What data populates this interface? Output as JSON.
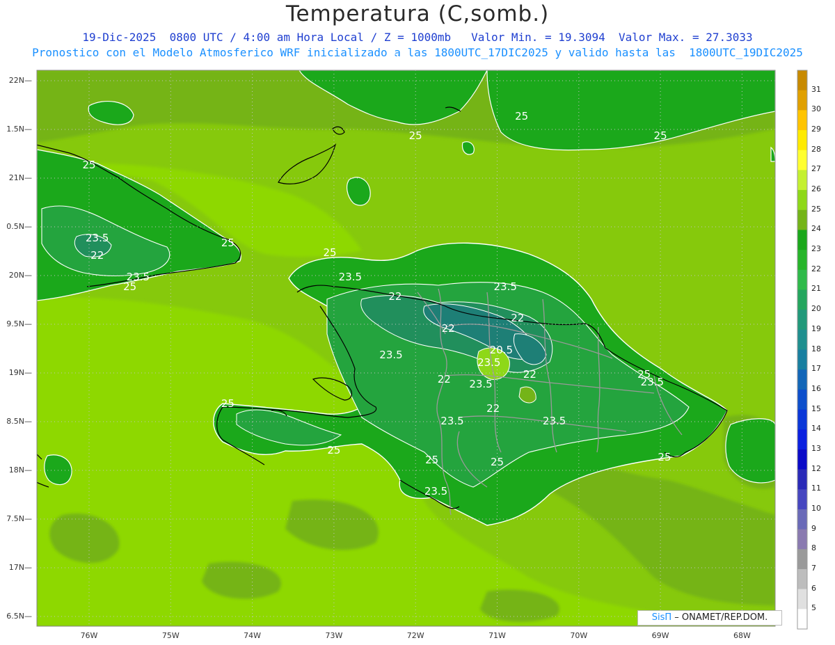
{
  "title": "Temperatura (C,somb.)",
  "subtitle_line1": "19-Dic-2025  0800 UTC / 4:00 am Hora Local / Z = 1000mb   Valor Min. = 19.3094  Valor Max. = 27.3033",
  "subtitle_line2": "Pronostico con el Modelo Atmosferico WRF inicializado a las 1800UTC_17DIC2025 y valido hasta las  1800UTC_19DIC2025",
  "credit": {
    "brand": "SisΠ",
    "text": " – ONAMET/REP.DOM."
  },
  "lat_labels": [
    "22N",
    "1.5N",
    "21N",
    "0.5N",
    "20N",
    "9.5N",
    "19N",
    "8.5N",
    "18N",
    "7.5N",
    "17N",
    "6.5N"
  ],
  "lon_labels": [
    "76W",
    "75W",
    "74W",
    "73W",
    "72W",
    "71W",
    "70W",
    "69W",
    "68W"
  ],
  "colorbar": {
    "levels": [
      "31",
      "30",
      "29",
      "28",
      "27",
      "26",
      "25",
      "24",
      "23",
      "22",
      "21",
      "20",
      "19",
      "18",
      "17",
      "16",
      "15",
      "14",
      "13",
      "12",
      "11",
      "10",
      "9",
      "8",
      "7",
      "6",
      "5"
    ],
    "colors": [
      "#c88a00",
      "#e0a000",
      "#ffc400",
      "#ffea00",
      "#ffff30",
      "#c4f030",
      "#8ed818",
      "#74b418",
      "#1ba81b",
      "#27b52a",
      "#2fba4a",
      "#24a65e",
      "#21997a",
      "#1f8f8f",
      "#187fa0",
      "#1266b8",
      "#0d4fcc",
      "#0a37d8",
      "#0a20e0",
      "#0a0ac8",
      "#2a2ab8",
      "#4646c0",
      "#6a6ab8",
      "#8a7ab0",
      "#9a9a9a",
      "#bdbdbd",
      "#e0e0e0",
      "#ffffff"
    ]
  },
  "map": {
    "colors": {
      "sea_bright": "#8ed800",
      "sea_mid": "#86c90c",
      "sea_deep": "#74b418",
      "land_warm": "#1ba81b",
      "land_mid": "#24a43e",
      "land_cool": "#218f5c",
      "land_cold": "#1e7f76",
      "coast": "#000000",
      "border": "#9a9a9a",
      "contour": "#ffffff"
    },
    "contour_labels": [
      {
        "text": "25",
        "lon": -72.2,
        "lat": 22.2
      },
      {
        "text": "25",
        "lon": -70.7,
        "lat": 21.6
      },
      {
        "text": "25",
        "lon": -72.0,
        "lat": 21.4
      },
      {
        "text": "25",
        "lon": -69.0,
        "lat": 21.4
      },
      {
        "text": "25",
        "lon": -76.0,
        "lat": 21.1
      },
      {
        "text": "25",
        "lon": -74.3,
        "lat": 20.3
      },
      {
        "text": "25",
        "lon": -75.5,
        "lat": 19.85
      },
      {
        "text": "25",
        "lon": -73.05,
        "lat": 20.2
      },
      {
        "text": "25",
        "lon": -74.3,
        "lat": 18.65
      },
      {
        "text": "25",
        "lon": -73.0,
        "lat": 18.17
      },
      {
        "text": "25",
        "lon": -71.8,
        "lat": 18.07
      },
      {
        "text": "25",
        "lon": -71.0,
        "lat": 18.05
      },
      {
        "text": "25",
        "lon": -69.2,
        "lat": 18.95
      },
      {
        "text": "25",
        "lon": -68.95,
        "lat": 18.1
      },
      {
        "text": "23.5",
        "lon": -75.9,
        "lat": 20.35
      },
      {
        "text": "22",
        "lon": -75.9,
        "lat": 20.17
      },
      {
        "text": "23.5",
        "lon": -75.4,
        "lat": 19.95
      },
      {
        "text": "23.5",
        "lon": -72.8,
        "lat": 19.95
      },
      {
        "text": "22",
        "lon": -72.25,
        "lat": 19.75
      },
      {
        "text": "23.5",
        "lon": -70.9,
        "lat": 19.85
      },
      {
        "text": "22",
        "lon": -70.75,
        "lat": 19.53
      },
      {
        "text": "22",
        "lon": -71.6,
        "lat": 19.42
      },
      {
        "text": "23.5",
        "lon": -72.3,
        "lat": 19.15
      },
      {
        "text": "20.5",
        "lon": -70.95,
        "lat": 19.2
      },
      {
        "text": "23.5",
        "lon": -71.1,
        "lat": 19.07
      },
      {
        "text": "22",
        "lon": -70.6,
        "lat": 18.95
      },
      {
        "text": "22",
        "lon": -71.65,
        "lat": 18.9
      },
      {
        "text": "23.5",
        "lon": -71.2,
        "lat": 18.85
      },
      {
        "text": "23.5",
        "lon": -69.1,
        "lat": 18.87
      },
      {
        "text": "22",
        "lon": -71.05,
        "lat": 18.6
      },
      {
        "text": "23.5",
        "lon": -71.55,
        "lat": 18.47
      },
      {
        "text": "23.5",
        "lon": -70.3,
        "lat": 18.47
      },
      {
        "text": "23.5",
        "lon": -71.75,
        "lat": 17.75
      }
    ]
  }
}
